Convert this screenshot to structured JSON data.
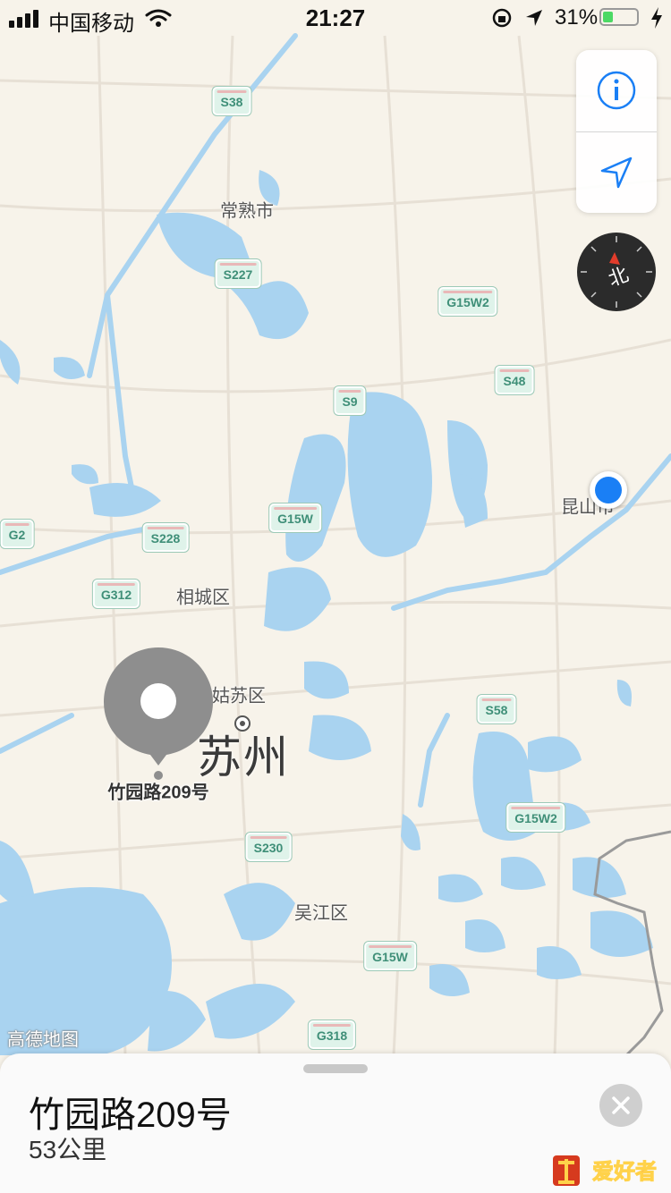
{
  "status_bar": {
    "carrier": "中国移动",
    "time": "21:27",
    "battery_percent": "31%",
    "battery_level": 0.31,
    "icons": [
      "signal-icon",
      "wifi-icon",
      "orientation-lock-icon",
      "location-arrow-icon",
      "battery-icon",
      "charging-icon"
    ]
  },
  "map": {
    "road_shields": [
      "S38",
      "S227",
      "G15W2",
      "S48",
      "S9",
      "G15W",
      "G2",
      "S228",
      "G312",
      "S58",
      "G15W2",
      "S230",
      "G15W",
      "G318"
    ],
    "places": [
      "常熟市",
      "相城区",
      "姑苏区",
      "吴江区",
      "昆山市"
    ],
    "city": "苏州",
    "pin_label": "竹园路209号",
    "attribution": "高德地图",
    "compass_label": "北"
  },
  "controls": {
    "info_icon": "info-icon",
    "location_icon": "location-arrow-icon"
  },
  "card": {
    "title": "竹园路209号",
    "subtitle": "53公里"
  },
  "watermark": "爱好者",
  "colors": {
    "land": "#f7f3ea",
    "water": "#a9d3f0",
    "accent": "#1a7ff5",
    "shield": "#dff3ea",
    "pin": "#8e8e8e"
  }
}
